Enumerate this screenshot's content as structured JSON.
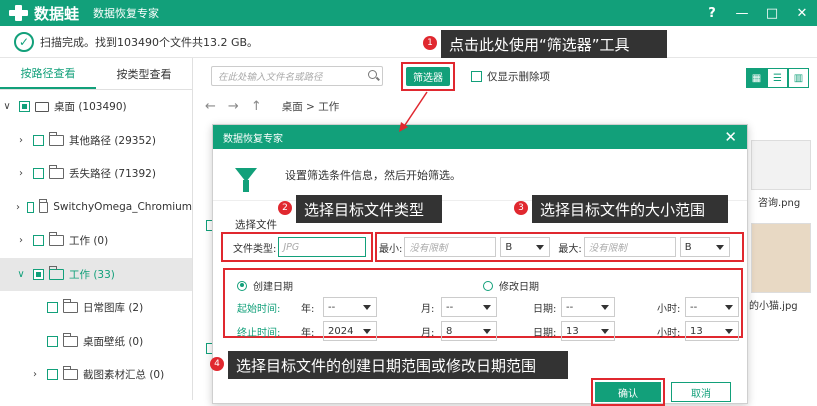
{
  "app": {
    "logo_text": "数据蛙",
    "title": "数据恢复专家"
  },
  "window": {
    "help": "?",
    "minimize": "—",
    "maximize": "□",
    "close": "✕"
  },
  "status": {
    "text": "扫描完成。找到103490个文件共13.2 GB。"
  },
  "sidebar": {
    "tabs": [
      "按路径查看",
      "按类型查看"
    ],
    "items": [
      {
        "label": "桌面 (103490)"
      },
      {
        "label": "其他路径 (29352)"
      },
      {
        "label": "丢失路径 (71392)"
      },
      {
        "label": "SwitchyOmega_Chromium"
      },
      {
        "label": "工作 (0)"
      },
      {
        "label": "工作 (33)"
      },
      {
        "label": "日常图库 (2)"
      },
      {
        "label": "桌面壁纸 (0)"
      },
      {
        "label": "截图素材汇总 (0)"
      }
    ]
  },
  "toolbar": {
    "search_placeholder": "在此处输入文件名或路径",
    "filter_label": "筛选器",
    "show_deleted_label": "仅显示删除项"
  },
  "nav": {
    "breadcrumb": "桌面 > 工作"
  },
  "bg_files": [
    "咨询.png",
    "的小猫.jpg"
  ],
  "dialog": {
    "title": "数据恢复专家",
    "instruction": "设置筛选条件信息，然后开始筛选。",
    "section_label": "选择文件",
    "file_type_label": "文件类型:",
    "file_type_placeholder": "JPG",
    "min_label": "最小:",
    "max_label": "最大:",
    "size_placeholder": "没有限制",
    "size_unit": "B",
    "created_label": "创建日期",
    "modified_label": "修改日期",
    "start_label": "起始时间:",
    "end_label": "终止时间:",
    "year_label": "年:",
    "month_label": "月:",
    "day_label": "日期:",
    "hour_label": "小时:",
    "start": {
      "year": "--",
      "month": "--",
      "day": "--",
      "hour": "--"
    },
    "end": {
      "year": "2024",
      "month": "8",
      "day": "13",
      "hour": "13"
    },
    "ok": "确认",
    "cancel": "取消"
  },
  "callouts": [
    {
      "num": "1",
      "text": "点击此处使用“筛选器”工具"
    },
    {
      "num": "2",
      "text": "选择目标文件类型"
    },
    {
      "num": "3",
      "text": "选择目标文件的大小范围"
    },
    {
      "num": "4",
      "text": "选择目标文件的创建日期范围或修改日期范围"
    }
  ],
  "colors": {
    "brand": "#12a07a",
    "highlight": "#e0282f",
    "callout_bg": "#333333"
  }
}
